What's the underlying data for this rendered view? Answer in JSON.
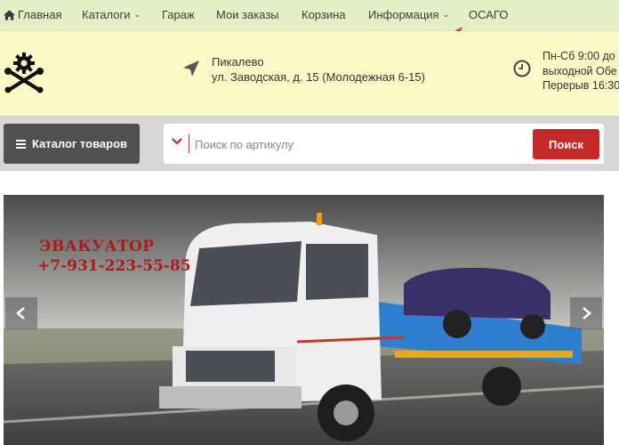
{
  "nav": {
    "home": "Главная",
    "catalogs": "Каталоги",
    "garage": "Гараж",
    "orders": "Мои заказы",
    "cart": "Корзина",
    "info": "Информация",
    "osago": "ОСАГО"
  },
  "header": {
    "city": "Пикалево",
    "address": "ул. Заводская, д. 15 (Молодежная 6-15)",
    "hours_line1": "Пн-Сб 9:00 до 1",
    "hours_line2": "выходной Обе",
    "hours_line3": "Перерыв 16:30"
  },
  "search": {
    "catalog_label": "Каталог товаров",
    "placeholder": "Поиск по артикулу",
    "button_label": "Поиск"
  },
  "banner": {
    "title": "ЭВАКУАТОР",
    "phone": "+7-931-223-55-85"
  },
  "colors": {
    "nav_bg": "#e3f0c5",
    "header_bg": "#fbfac6",
    "search_button": "#c62828",
    "catalog_button": "#515151"
  }
}
